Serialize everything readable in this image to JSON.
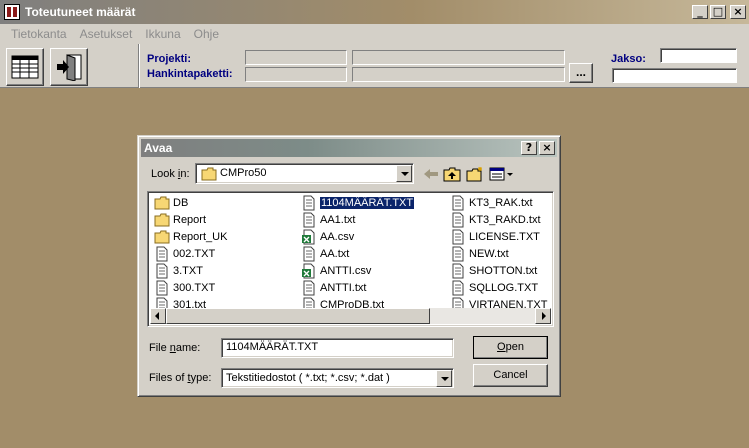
{
  "window": {
    "title": "Toteutuneet määrät"
  },
  "menu": [
    "Tietokanta",
    "Asetukset",
    "Ikkuna",
    "Ohje"
  ],
  "toolbar": {
    "projekti_label": "Projekti:",
    "hankinta_label": "Hankintapaketti:",
    "jakso_label": "Jakso:",
    "dots_label": "..."
  },
  "dialog": {
    "title": "Avaa",
    "help_btn": "?",
    "close_btn": "×",
    "lookin_label_pre": "Look ",
    "lookin_label_key": "i",
    "lookin_label_post": "n:",
    "lookin_value": "CMPro50",
    "files": [
      {
        "name": "DB",
        "icon": "folder-icon"
      },
      {
        "name": "Report",
        "icon": "folder-icon"
      },
      {
        "name": "Report_UK",
        "icon": "folder-icon"
      },
      {
        "name": "002.TXT",
        "icon": "text-file-icon"
      },
      {
        "name": "3.TXT",
        "icon": "text-file-icon"
      },
      {
        "name": "300.TXT",
        "icon": "text-file-icon"
      },
      {
        "name": "301.txt",
        "icon": "text-file-icon"
      },
      {
        "name": "1104MÄÄRÄT.TXT",
        "icon": "text-file-icon",
        "selected": true
      },
      {
        "name": "AA1.txt",
        "icon": "text-file-icon"
      },
      {
        "name": "AA.csv",
        "icon": "excel-file-icon"
      },
      {
        "name": "AA.txt",
        "icon": "text-file-icon"
      },
      {
        "name": "ANTTI.csv",
        "icon": "excel-file-icon"
      },
      {
        "name": "ANTTI.txt",
        "icon": "text-file-icon"
      },
      {
        "name": "CMProDB.txt",
        "icon": "text-file-icon"
      },
      {
        "name": "KT3_RAK.txt",
        "icon": "text-file-icon"
      },
      {
        "name": "KT3_RAKD.txt",
        "icon": "text-file-icon"
      },
      {
        "name": "LICENSE.TXT",
        "icon": "text-file-icon"
      },
      {
        "name": "NEW.txt",
        "icon": "text-file-icon"
      },
      {
        "name": "SHOTTON.txt",
        "icon": "text-file-icon"
      },
      {
        "name": "SQLLOG.TXT",
        "icon": "text-file-icon"
      },
      {
        "name": "VIRTANEN.TXT",
        "icon": "text-file-icon"
      }
    ],
    "filename_label_pre": "File ",
    "filename_label_key": "n",
    "filename_label_post": "ame:",
    "filename_value": "1104MÄÄRÄT.TXT",
    "filetype_label_pre": "Files of ",
    "filetype_label_key": "t",
    "filetype_label_post": "ype:",
    "filetype_value": "Tekstitiedostot ( *.txt; *.csv; *.dat )",
    "open_key": "O",
    "open_rest": "pen",
    "cancel_label": "Cancel"
  }
}
